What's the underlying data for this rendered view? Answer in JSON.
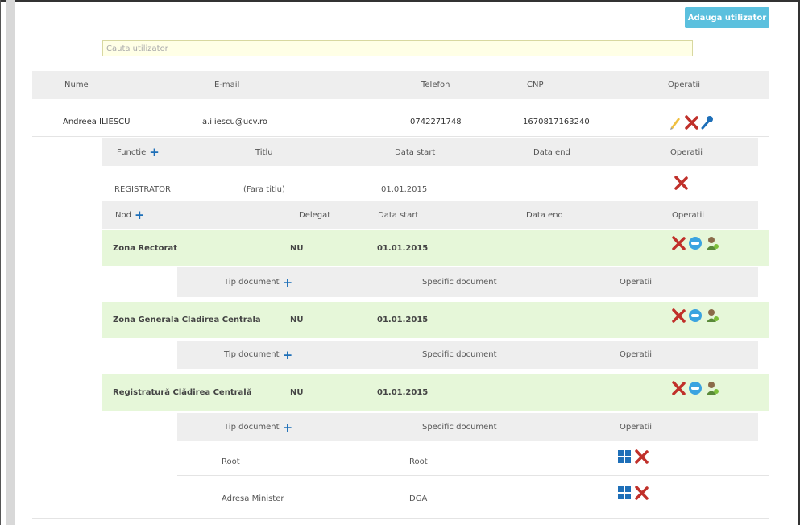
{
  "add_user_label": "Adauga utilizator",
  "search": {
    "placeholder": "Cauta utilizator"
  },
  "users_table": {
    "headers": {
      "name": "Nume",
      "email": "E-mail",
      "phone": "Telefon",
      "cnp": "CNP",
      "operations": "Operatii"
    },
    "user": {
      "name": "Andreea ILIESCU",
      "email": "a.iliescu@ucv.ro",
      "phone": "0742271748",
      "cnp": "1670817163240"
    }
  },
  "functions_table": {
    "headers": {
      "function": "Functie",
      "title": "Titlu",
      "start": "Data start",
      "end": "Data end",
      "operations": "Operatii"
    },
    "row": {
      "function": "REGISTRATOR",
      "title": "(Fara titlu)",
      "start": "01.01.2015",
      "end": ""
    }
  },
  "nodes_table": {
    "headers": {
      "node": "Nod",
      "delegate": "Delegat",
      "start": "Data start",
      "end": "Data end",
      "operations": "Operatii"
    },
    "nodes": [
      {
        "name": "Zona Rectorat",
        "delegate": "NU",
        "start": "01.01.2015"
      },
      {
        "name": "Zona Generala Cladirea Centrala",
        "delegate": "NU",
        "start": "01.01.2015"
      },
      {
        "name": "Registratură Clădirea Centrală",
        "delegate": "NU",
        "start": "01.01.2015"
      }
    ]
  },
  "doc_table": {
    "headers": {
      "type": "Tip document",
      "specific": "Specific document",
      "operations": "Operatii"
    },
    "rows": [
      {
        "type": "Root",
        "specific": "Root"
      },
      {
        "type": "Adresa Minister",
        "specific": "DGA"
      }
    ]
  },
  "colors": {
    "accent": "#5bc0de",
    "green_row": "#e6f7d9",
    "header_row": "#eeeeee",
    "delete_red": "#c0302a",
    "plus_blue": "#1e6fb8"
  },
  "icons": [
    "edit-pencil-icon",
    "delete-x-icon",
    "key-icon",
    "plus-icon",
    "user-settings-icon",
    "user-add-icon",
    "grid-icon"
  ]
}
